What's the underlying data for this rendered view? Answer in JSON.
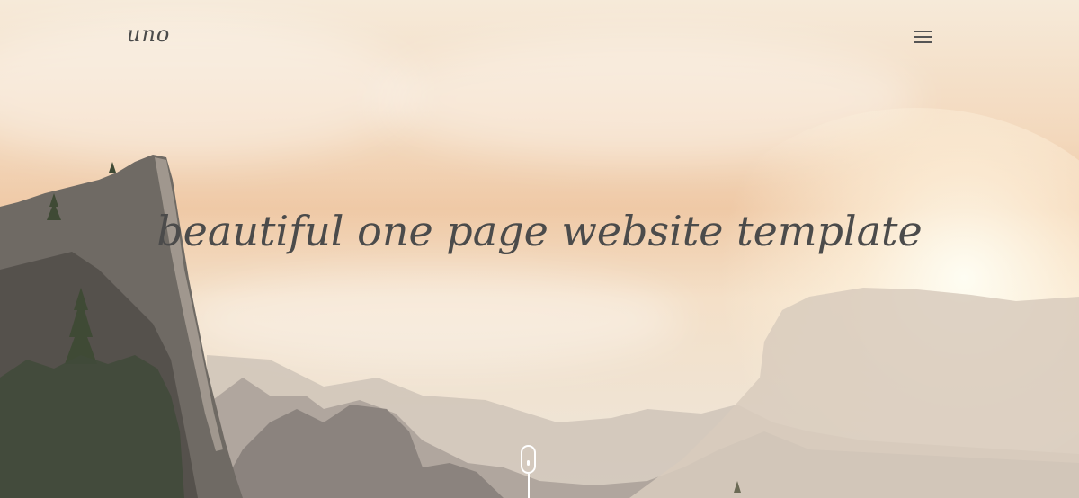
{
  "header": {
    "logo_text": "uno",
    "menu_icon": "hamburger-menu-icon"
  },
  "hero": {
    "headline": "beautiful one page website template",
    "scroll_icon": "mouse-scroll-icon"
  },
  "colors": {
    "text": "#4b4b4b",
    "icon": "#555555",
    "scroll_indicator": "#ffffff",
    "sky_top": "#f6ead9",
    "sky_mid": "#efc9a6",
    "rock_dark": "#5e5a54"
  }
}
